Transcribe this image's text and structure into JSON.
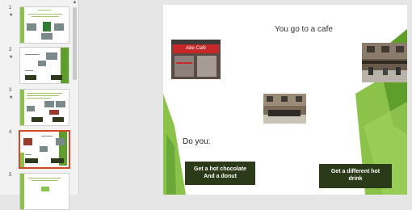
{
  "thumbnails": [
    {
      "number": "1",
      "star": "★"
    },
    {
      "number": "2",
      "star": "★"
    },
    {
      "number": "3",
      "star": "★"
    },
    {
      "number": "4",
      "star": ""
    },
    {
      "number": "5",
      "star": ""
    }
  ],
  "slide": {
    "title": "You go to a cafe",
    "question": "Do you:",
    "choice_a": "Get a hot chocolate\nAnd a donut",
    "choice_b": "Get a different hot\ndrink",
    "cafe_sign": "Abe Café"
  },
  "colors": {
    "accent_green": "#8bc34a",
    "dark_green": "#2b3a18",
    "selection": "#d24726"
  }
}
